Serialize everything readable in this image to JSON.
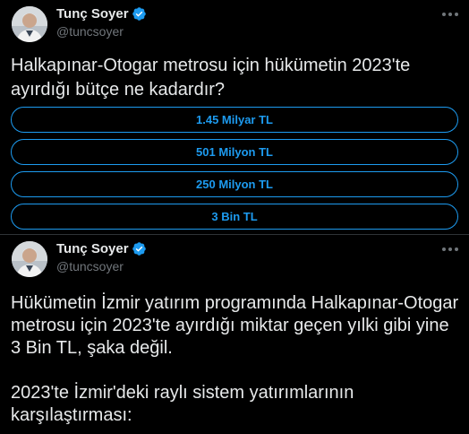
{
  "tweet1": {
    "author_name": "Tunç Soyer",
    "author_handle": "@tuncsoyer",
    "question": "Halkapınar-Otogar metrosu için hükümetin 2023'te ayırdığı bütçe ne kadardır?",
    "poll_options": [
      "1.45 Milyar TL",
      "501 Milyon TL",
      "250 Milyon TL",
      "3 Bin TL"
    ]
  },
  "tweet2": {
    "author_name": "Tunç Soyer",
    "author_handle": "@tuncsoyer",
    "paragraph1": "Hükümetin İzmir yatırım programında Halkapınar-Otogar metrosu için 2023'te ayırdığı miktar geçen yılki gibi yine 3 Bin TL, şaka değil.",
    "paragraph2": "2023'te İzmir'deki raylı sistem yatırımlarının karşılaştırması:"
  },
  "icons": {
    "verified": "verified-badge-icon",
    "more": "more-options-icon"
  },
  "colors": {
    "background": "#000000",
    "accent": "#1d9bf0",
    "text": "#e7e9ea",
    "secondary_text": "#71767b",
    "divider": "#2f3336"
  }
}
